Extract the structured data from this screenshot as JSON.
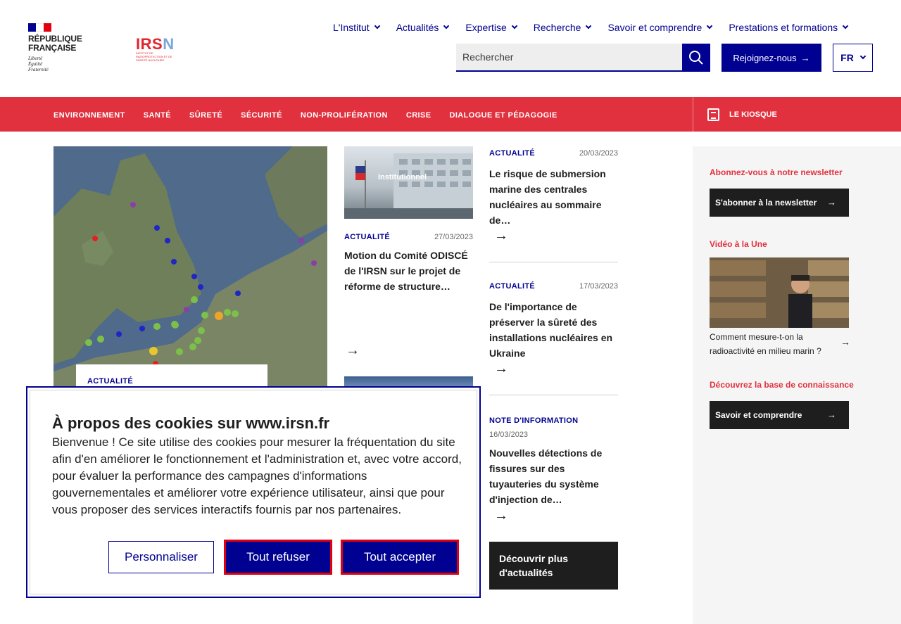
{
  "header": {
    "republique": "RÉPUBLIQUE FRANÇAISE",
    "republique_line1": "RÉPUBLIQUE",
    "republique_line2": "FRANÇAISE",
    "devise": [
      "Liberté",
      "Égalité",
      "Fraternité"
    ],
    "irsn_logo": "IRSN",
    "irsn_sub": "INSTITUT DE RADIOPROTECTION ET DE SÛRETÉ NUCLÉAIRE",
    "nav": [
      "L'Institut",
      "Actualités",
      "Expertise",
      "Recherche",
      "Savoir et comprendre",
      "Prestations et formations"
    ],
    "search_placeholder": "Rechercher",
    "join_label": "Rejoignez-nous",
    "lang": "FR"
  },
  "themes": [
    "ENVIRONNEMENT",
    "SANTÉ",
    "SÛRETÉ",
    "SÉCURITÉ",
    "NON-PROLIFÉRATION",
    "CRISE",
    "DIALOGUE ET PÉDAGOGIE"
  ],
  "kiosk_label": "LE KIOSQUE",
  "map_card": {
    "kicker": "ACTUALITÉ"
  },
  "news_col1": {
    "thumb_label": "Institutionnel",
    "item1": {
      "kicker": "ACTUALITÉ",
      "date": "27/03/2023",
      "title": "Motion du Comité ODISCÉ de l'IRSN sur le projet de réforme de structure…"
    }
  },
  "news_col2": [
    {
      "kicker": "ACTUALITÉ",
      "date": "20/03/2023",
      "title": "Le risque de submersion marine des centrales nucléaires au sommaire de…"
    },
    {
      "kicker": "ACTUALITÉ",
      "date": "17/03/2023",
      "title": "De l'importance de préserver la sûreté des installations nucléaires en Ukraine"
    },
    {
      "kicker": "NOTE D'INFORMATION",
      "date": "16/03/2023",
      "title": "Nouvelles détections de fissures sur des tuyauteries du système d'injection de…"
    }
  ],
  "more_news": "Découvrir plus d'actualités",
  "sidebar": {
    "newsletter_heading": "Abonnez-vous à notre newsletter",
    "newsletter_button": "S'abonner à la newsletter",
    "video_heading": "Vidéo à la Une",
    "video_caption": "Comment mesure-t-on la radioactivité en milieu marin ?",
    "kb_heading": "Découvrez la base de connaissance",
    "kb_button": "Savoir et comprendre"
  },
  "cookie": {
    "title": "À propos des cookies sur www.irsn.fr",
    "text": "Bienvenue ! Ce site utilise des cookies pour mesurer la fréquentation du site afin d'en améliorer le fonctionnement et l'administration et, avec votre accord, pour évaluer la performance des campagnes d'informations gouvernementales et améliorer votre expérience utilisateur, ainsi que pour vous proposer des services interactifs fournis par nos partenaires.",
    "customize": "Personnaliser",
    "refuse": "Tout refuser",
    "accept": "Tout accepter"
  },
  "colors": {
    "primary": "#000091",
    "brand_red": "#e1313f",
    "dark": "#1e1e1e"
  }
}
